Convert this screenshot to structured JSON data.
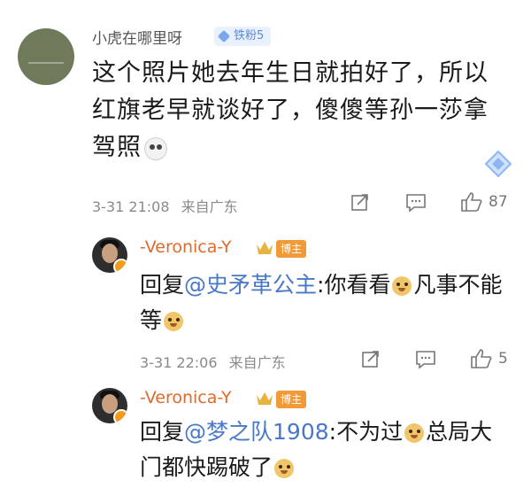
{
  "main_comment": {
    "username": "小虎在哪里呀",
    "fan_badge": "铁粉5",
    "text": "这个照片她去年生日就拍好了，所以红旗老早就谈好了，傻傻等孙一莎拿驾照",
    "timestamp": "3-31 21:08",
    "source": "来自广东",
    "like_count": "87"
  },
  "replies": [
    {
      "username": "-Veronica-Y",
      "tag": "博主",
      "prefix": "回复",
      "mention": "@史矛革公主",
      "text_a": ":你看看",
      "text_b": "凡事不能等",
      "timestamp": "3-31 22:06",
      "source": "来自广东",
      "like_count": "5"
    },
    {
      "username": "-Veronica-Y",
      "tag": "博主",
      "prefix": "回复",
      "mention": "@梦之队1908",
      "text_a": ":不为过",
      "text_b": "总局大门都快踢破了"
    }
  ]
}
